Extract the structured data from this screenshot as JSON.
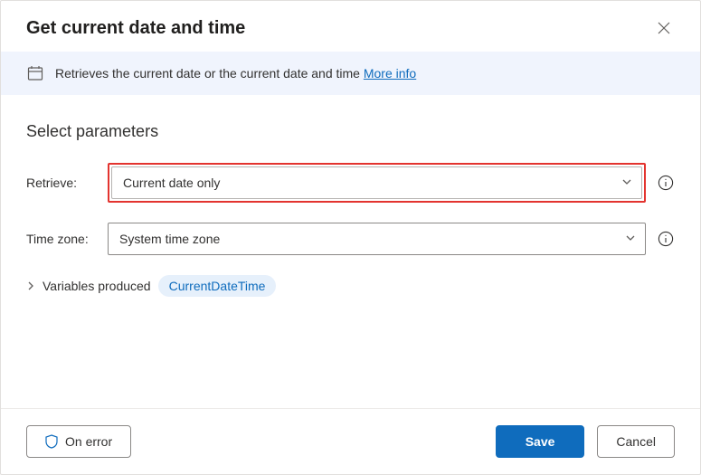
{
  "header": {
    "title": "Get current date and time"
  },
  "info_bar": {
    "text": "Retrieves the current date or the current date and time ",
    "more_label": "More info"
  },
  "params": {
    "section_title": "Select parameters",
    "retrieve": {
      "label": "Retrieve:",
      "value": "Current date only"
    },
    "timezone": {
      "label": "Time zone:",
      "value": "System time zone"
    }
  },
  "variables": {
    "label": "Variables produced",
    "chip": "CurrentDateTime"
  },
  "footer": {
    "on_error": "On error",
    "save": "Save",
    "cancel": "Cancel"
  }
}
